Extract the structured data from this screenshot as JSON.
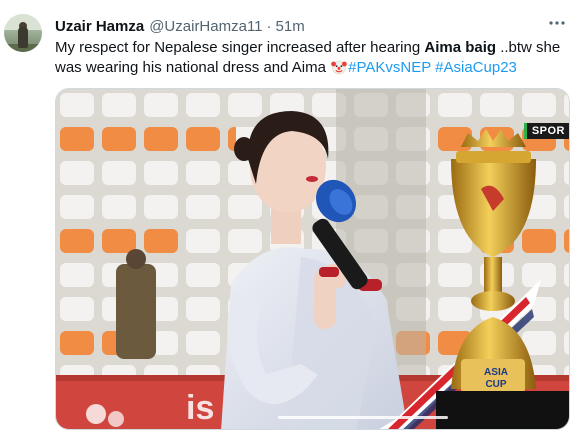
{
  "tweet": {
    "author": {
      "name": "Uzair Hamza",
      "handle": "@UzairHamza11",
      "separator": "·",
      "time": "51m"
    },
    "text": {
      "part1": "My respect for Nepalese singer increased after hearing ",
      "bold1": "Aima baig",
      "part2": " ..btw she was wearing his national dress and Aima ",
      "emoji_icon": "clown-face-icon",
      "hashtag1": "#PAKvsNEP",
      "hashtag2": "#AsiaCup23"
    },
    "media": {
      "channel_logo": "SPOR"
    }
  }
}
